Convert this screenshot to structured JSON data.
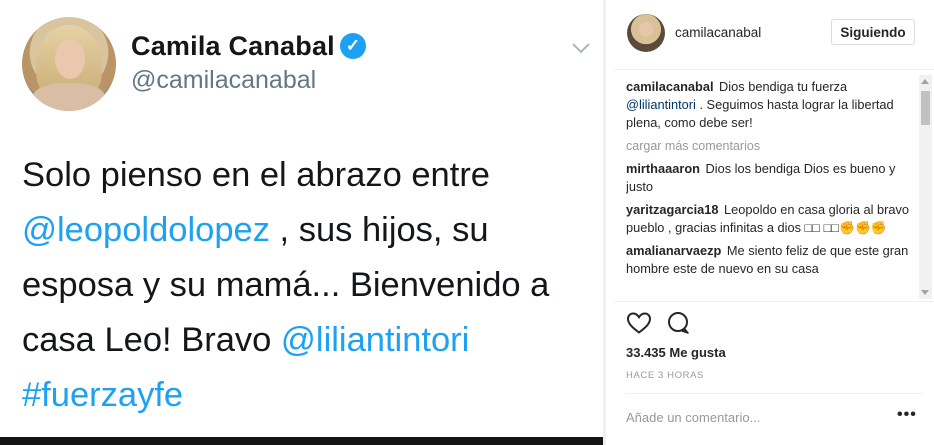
{
  "tweet": {
    "name": "Camila Canabal",
    "handle": "@camilacanabal",
    "body": {
      "p1": "Solo pienso en el abrazo entre ",
      "mention1": "@leopoldolopez",
      "p2": " , sus hijos, su esposa y su mamá...  Bienvenido a casa Leo! Bravo ",
      "mention2": "@liliantintori",
      "hashtag": "#fuerzayfe"
    },
    "icons": {
      "verified": "verified-badge-icon",
      "menu": "chevron-down-icon"
    },
    "colors": {
      "link": "#1da1f2",
      "text": "#14171a",
      "handle": "#657786"
    }
  },
  "instagram": {
    "username": "camilacanabal",
    "follow_label": "Siguiendo",
    "caption": {
      "user": "camilacanabal",
      "text1": " Dios bendiga tu fuerza ",
      "mention": "@liliantintori",
      "text2": " . Seguimos hasta lograr la libertad plena, como debe ser!"
    },
    "load_more": "cargar más comentarios",
    "comments": [
      {
        "user": "mirthaaaron",
        "text": " Dios los bendiga Dios es bueno y justo"
      },
      {
        "user": "yaritzagarcia18",
        "text": " Leopoldo en casa gloria al bravo pueblo , gracias infinitas a dios □□ □□✊✊✊"
      },
      {
        "user": "amalianarvaezp",
        "text": " Me siento feliz de que este gran hombre este de nuevo en su casa"
      }
    ],
    "likes": "33.435 Me gusta",
    "time": "HACE 3 HORAS",
    "add_comment_placeholder": "Añade un comentario...",
    "more_label": "•••",
    "icons": {
      "like": "heart-icon",
      "comment": "comment-bubble-icon"
    }
  }
}
